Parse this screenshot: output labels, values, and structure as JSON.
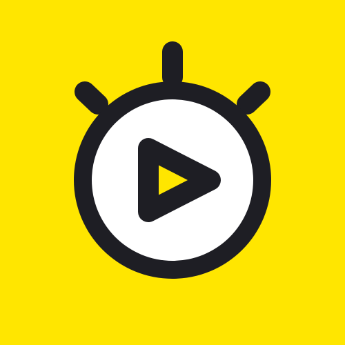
{
  "logo": {
    "icon": "stopwatch-play-icon",
    "colors": {
      "background": "#FFE600",
      "outline": "#1E1E24",
      "face": "#FFFFFF",
      "play_fill": "#FFE600"
    }
  }
}
